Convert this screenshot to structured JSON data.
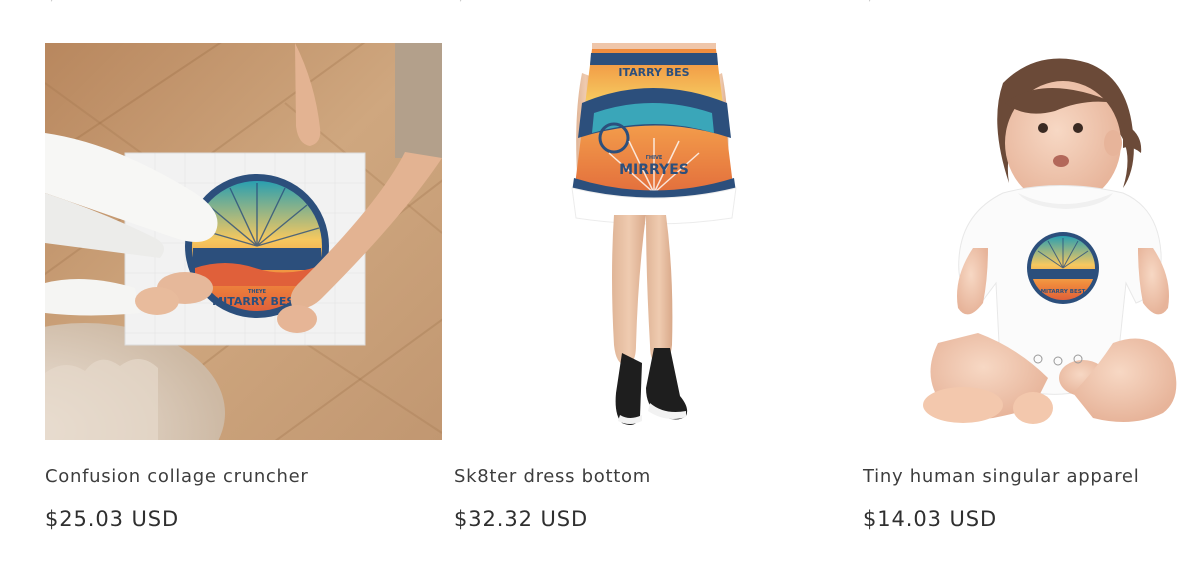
{
  "products": [
    {
      "title": "Confusion collage cruncher",
      "price": "$25.03 USD",
      "image_alt": "Jigsaw puzzle with sunset emblem on wooden floor"
    },
    {
      "title": "Sk8ter dress bottom",
      "price": "$32.32 USD",
      "image_alt": "Skater skirt with sunset emblem print"
    },
    {
      "title": "Tiny human singular apparel",
      "price": "$14.03 USD",
      "image_alt": "Baby wearing white onesie with sunset emblem"
    }
  ],
  "emblem": {
    "text": "MITARRY BEST",
    "small_text": "THEYE",
    "small_text_skirt": "ΓHIVE",
    "text_skirt": "MIRRYES",
    "text_skirt_top": "ITARRY BES"
  },
  "colors": {
    "wood": "#c9a27a",
    "emblem_orange": "#f08a3c",
    "emblem_blue": "#2c4f7c",
    "emblem_yellow": "#f6c85f",
    "emblem_teal": "#3aa6b9"
  }
}
